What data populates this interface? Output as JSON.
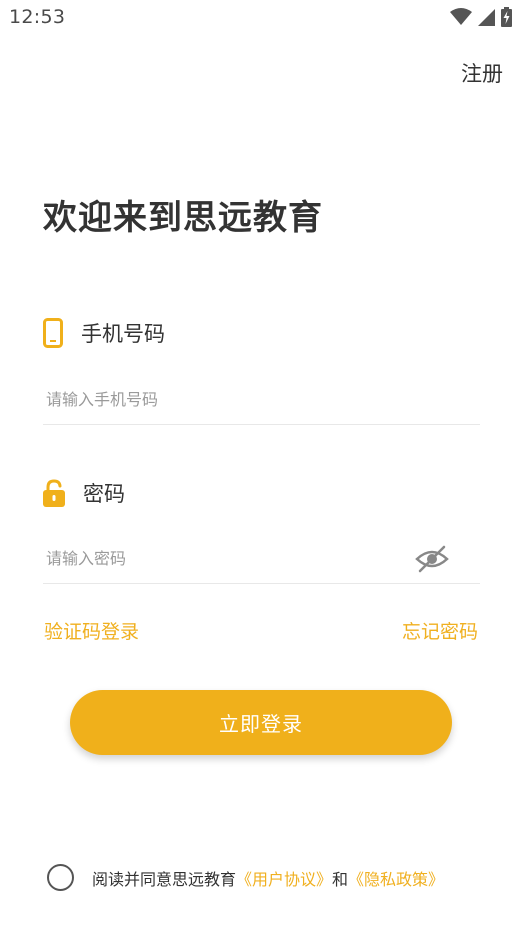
{
  "status_bar": {
    "time": "12:53",
    "icons": [
      "wifi-icon",
      "signal-icon",
      "battery-charging-icon"
    ]
  },
  "header": {
    "register_label": "注册"
  },
  "welcome": {
    "title": "欢迎来到思远教育"
  },
  "phone_field": {
    "label": "手机号码",
    "icon": "phone-icon",
    "placeholder": "请输入手机号码",
    "value": ""
  },
  "password_field": {
    "label": "密码",
    "icon": "unlock-icon",
    "placeholder": "请输入密码",
    "value": "",
    "toggle_icon": "eye-off-icon"
  },
  "links": {
    "sms_login": "验证码登录",
    "forgot_password": "忘记密码"
  },
  "login_button": {
    "label": "立即登录"
  },
  "agreement": {
    "checked": false,
    "prefix": "阅读并同意思远教育",
    "user_agreement": "《用户协议》",
    "conjunction": "和",
    "privacy_policy": "《隐私政策》"
  },
  "colors": {
    "accent": "#f0b01b",
    "text": "#333333",
    "placeholder": "#9a9a9a",
    "divider": "#e8e8e8"
  }
}
